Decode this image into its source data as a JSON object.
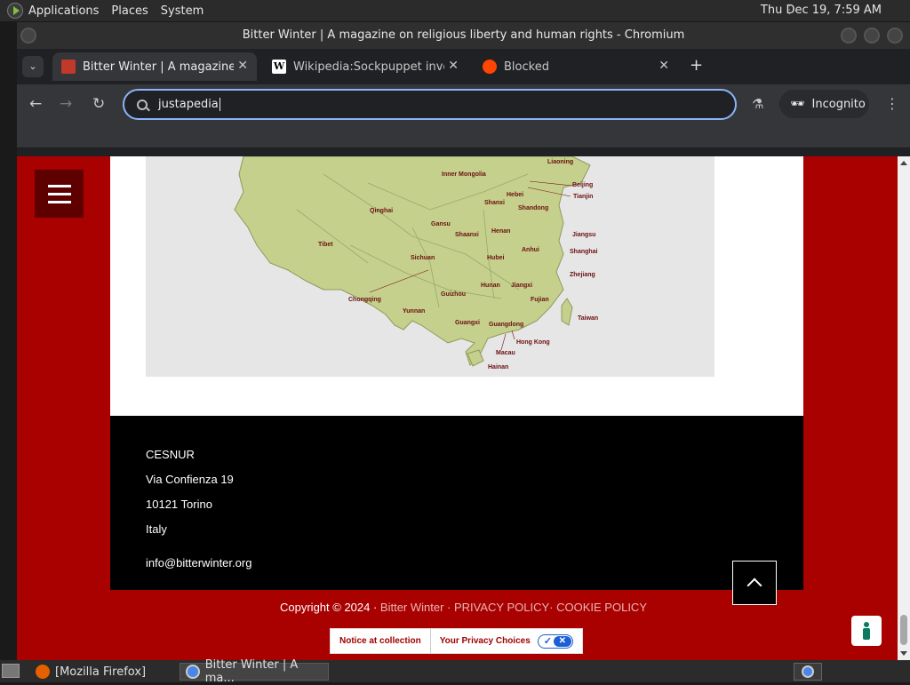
{
  "top_panel": {
    "menus": [
      "Applications",
      "Places",
      "System"
    ],
    "clock": "Thu Dec 19,  7:59 AM"
  },
  "window": {
    "title": "Bitter Winter | A magazine on religious liberty and human rights - Chromium"
  },
  "tabs": [
    {
      "label": "Bitter Winter | A magazine on",
      "favicon_color": "#c0392b",
      "active": true
    },
    {
      "label": "Wikipedia:Sockpuppet inves",
      "favicon_color": "#ffffff",
      "active": false
    },
    {
      "label": "Blocked",
      "favicon_color": "#ff4500",
      "active": false
    }
  ],
  "toolbar": {
    "omnibox_value": "justapedia",
    "incognito_label": "Incognito"
  },
  "map": {
    "provinces": [
      "Inner Mongolia",
      "Liaoning",
      "Beijing",
      "Tianjin",
      "Hebei",
      "Shanxi",
      "Shandong",
      "Qinghai",
      "Gansu",
      "Shaanxi",
      "Henan",
      "Jiangsu",
      "Tibet",
      "Anhui",
      "Shanghai",
      "Sichuan",
      "Hubei",
      "Zhejiang",
      "Hunan",
      "Jiangxi",
      "Chongqing",
      "Guizhou",
      "Fujian",
      "Yunnan",
      "Guangxi",
      "Guangdong",
      "Taiwan",
      "Hong Kong",
      "Macau",
      "Hainan"
    ]
  },
  "footer": {
    "org": "CESNUR",
    "street": "Via Confienza 19",
    "city": "10121 Torino",
    "country": "Italy",
    "email": "info@bitterwinter.org"
  },
  "copyright": {
    "prefix": "Copyright © 2024 · ",
    "site_link": "Bitter Winter",
    "sep1": " · ",
    "privacy_link": "PRIVACY POLICY",
    "sep2": "· ",
    "cookie_link": "COOKIE POLICY"
  },
  "privacy_bar": {
    "notice": "Notice at collection",
    "choices": "Your Privacy Choices"
  },
  "taskbar": {
    "items": [
      "[Mozilla Firefox]",
      "Bitter Winter | A ma..."
    ]
  },
  "colors": {
    "site_red": "#a90000",
    "focus_blue": "#8ab4f8"
  }
}
